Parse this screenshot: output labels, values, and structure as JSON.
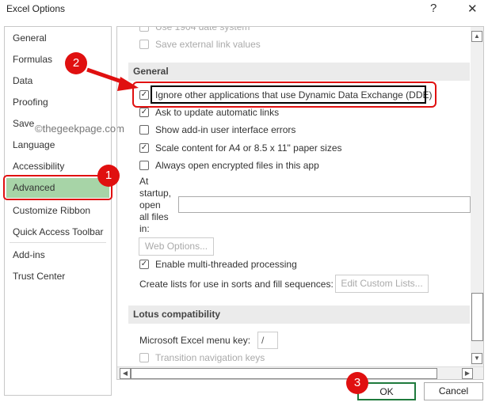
{
  "window": {
    "title": "Excel Options",
    "help": "?",
    "close": "✕"
  },
  "sidebar": {
    "items": [
      "General",
      "Formulas",
      "Data",
      "Proofing",
      "Save",
      "Language",
      "Accessibility",
      "Advanced",
      "Customize Ribbon",
      "Quick Access Toolbar",
      "Add-ins",
      "Trust Center"
    ],
    "selected": "Advanced"
  },
  "watermark": "©thegeekpage.com",
  "content": {
    "top_items": [
      {
        "label": "Use 1904 date system",
        "checked": false
      },
      {
        "label": "Save external link values",
        "checked": false
      }
    ],
    "general_header": "General",
    "general_items": [
      {
        "label": "Ignore other applications that use Dynamic Data Exchange (DDE)",
        "checked": true
      },
      {
        "label": "Ask to update automatic links",
        "checked": true
      },
      {
        "label": "Show add-in user interface errors",
        "checked": false
      },
      {
        "label": "Scale content for A4 or 8.5 x 11\" paper sizes",
        "checked": true
      },
      {
        "label": "Always open encrypted files in this app",
        "checked": false
      }
    ],
    "startup_label": [
      "At",
      "startup,",
      "open",
      "all files",
      "in:"
    ],
    "startup_value": "",
    "web_options": "Web Options...",
    "multithread": {
      "label": "Enable multi-threaded processing",
      "checked": true
    },
    "custom_lists_label": "Create lists for use in sorts and fill sequences:",
    "edit_custom_lists": "Edit Custom Lists...",
    "lotus_header": "Lotus compatibility",
    "menu_key_label": "Microsoft Excel menu key:",
    "menu_key_value": "/",
    "transition": {
      "label": "Transition navigation keys",
      "checked": false
    }
  },
  "footer": {
    "ok": "OK",
    "cancel": "Cancel"
  },
  "annotations": {
    "step1": "1",
    "step2": "2",
    "step3": "3",
    "color": "#e01010"
  }
}
